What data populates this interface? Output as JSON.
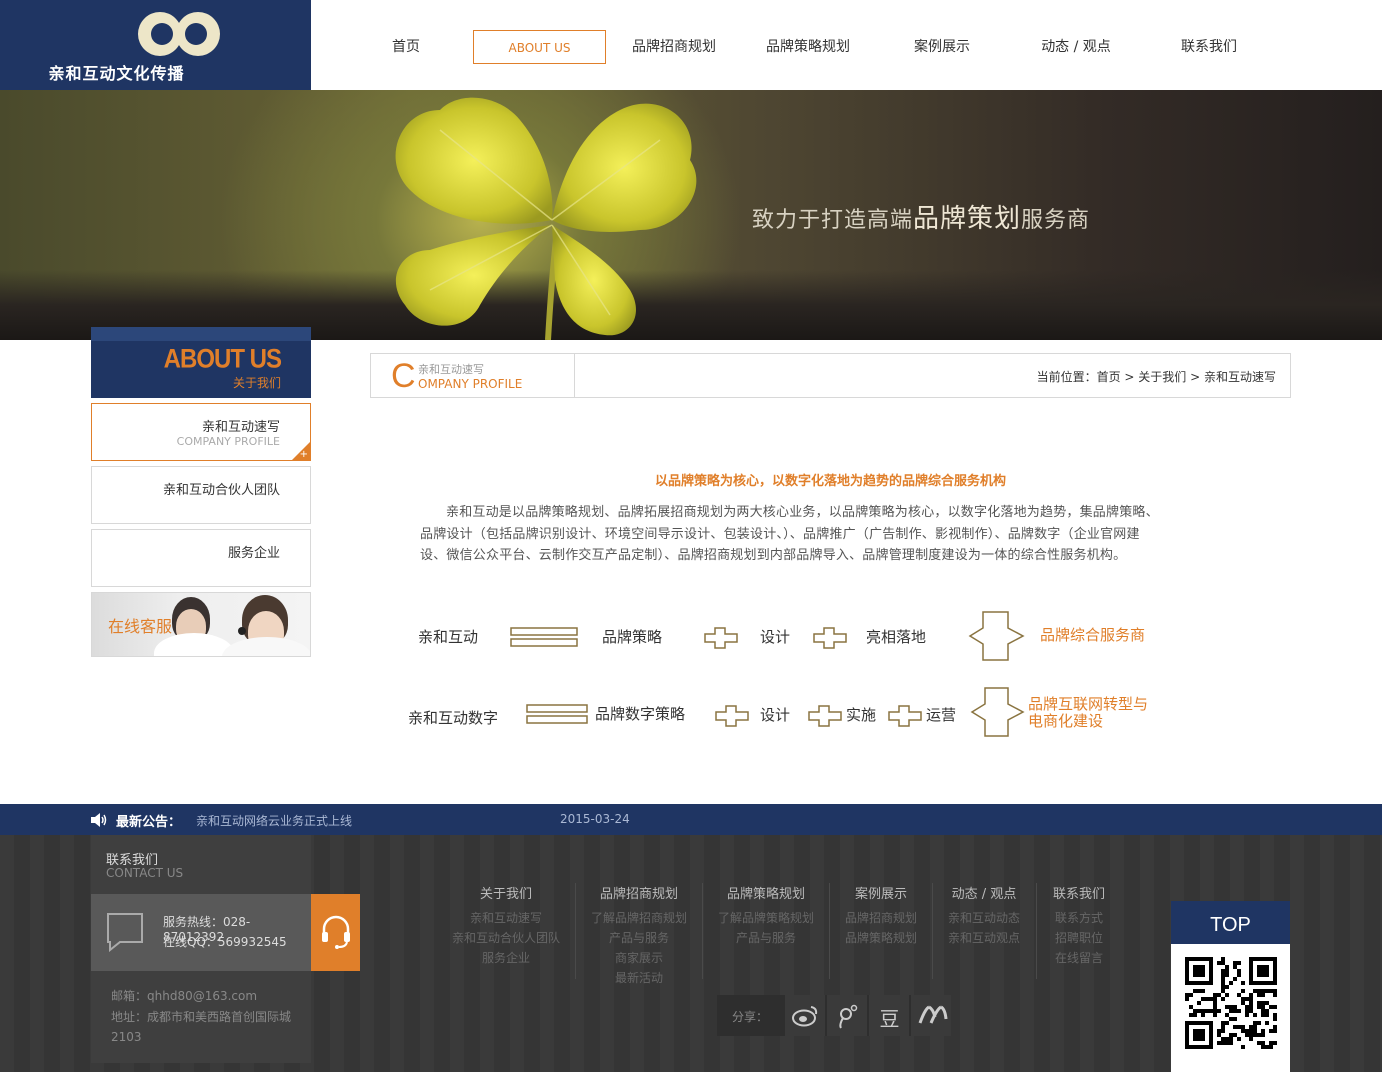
{
  "brand": {
    "name": "亲和互动文化传播"
  },
  "nav": {
    "items": [
      {
        "label": "首页"
      },
      {
        "label": "ABOUT US",
        "active": true
      },
      {
        "label": "品牌招商规划"
      },
      {
        "label": "品牌策略规划"
      },
      {
        "label": "案例展示"
      },
      {
        "label": "动态 / 观点"
      },
      {
        "label": "联系我们"
      }
    ]
  },
  "banner": {
    "slogan_pre": "致力于打造高端",
    "slogan_big": "品牌策划",
    "slogan_post": "服务商"
  },
  "sidebar": {
    "title": "ABOUT US",
    "subtitle": "关于我们",
    "items": [
      {
        "label": "亲和互动速写",
        "en": "COMPANY PROFILE",
        "active": true
      },
      {
        "label": "亲和互动合伙人团队",
        "en": ""
      },
      {
        "label": "服务企业",
        "en": ""
      }
    ],
    "service_label": "在线客服"
  },
  "content_header": {
    "letter": "C",
    "cn": "亲和互动速写",
    "en": "OMPANY PROFILE",
    "breadcrumb": {
      "prefix": "当前位置：",
      "home": "首页",
      "sep": " > ",
      "parent": "关于我们",
      "current": "亲和互动速写"
    }
  },
  "article": {
    "heading": "以品牌策略为核心，以数字化落地为趋势的品牌综合服务机构",
    "body": "亲和互动是以品牌策略规划、品牌拓展招商规划为两大核心业务，以品牌策略为核心，以数字化落地为趋势，集品牌策略、品牌设计（包括品牌识别设计、环境空间导示设计、包装设计、）、品牌推广（广告制作、影视制作）、品牌数字（企业官网建设、微信公众平台、云制作交互产品定制）、品牌招商规划到内部品牌导入、品牌管理制度建设为一体的综合性服务机构。"
  },
  "diagram": {
    "row1": {
      "start": "亲和互动",
      "a": "品牌策略",
      "b": "设计",
      "c": "亮相落地",
      "result": "品牌综合服务商"
    },
    "row2": {
      "start": "亲和互动数字",
      "a": "品牌数字策略",
      "b": "设计",
      "c": "实施",
      "d": "运营",
      "result1": "品牌互联网转型与",
      "result2": "电商化建设"
    }
  },
  "notice": {
    "label": "最新公告：",
    "text": "亲和互动网络云业务正式上线",
    "date": "2015-03-24"
  },
  "footer": {
    "contact": {
      "title": "联系我们",
      "en": "CONTACT US",
      "hotline": "服务热线：028-87012392",
      "qq": "在线QQ：569932545",
      "email": "邮箱：qhhd80@163.com",
      "address": "地址：成都市和美西路首创国际城2103"
    },
    "columns": [
      {
        "title": "关于我们",
        "links": [
          "亲和互动速写",
          "亲和互动合伙人团队",
          "服务企业"
        ]
      },
      {
        "title": "品牌招商规划",
        "links": [
          "了解品牌招商规划",
          "产品与服务",
          "商家展示",
          "最新活动"
        ]
      },
      {
        "title": "品牌策略规划",
        "links": [
          "了解品牌策略规划",
          "产品与服务"
        ]
      },
      {
        "title": "案例展示",
        "links": [
          "品牌招商规划",
          "品牌策略规划"
        ]
      },
      {
        "title": "动态 / 观点",
        "links": [
          "亲和互动动态",
          "亲和互动观点"
        ]
      },
      {
        "title": "联系我们",
        "links": [
          "联系方式",
          "招聘职位",
          "在线留言"
        ]
      }
    ],
    "share_label": "分享：",
    "share_icons": [
      "weibo-icon",
      "tencent-weibo-icon",
      "douban-icon",
      "renren-icon"
    ],
    "douban_glyph": "豆",
    "top_label": "TOP"
  },
  "colors": {
    "navy": "#1f3563",
    "accent": "#e07f2a",
    "footer_bg": "#3a3a3a"
  }
}
